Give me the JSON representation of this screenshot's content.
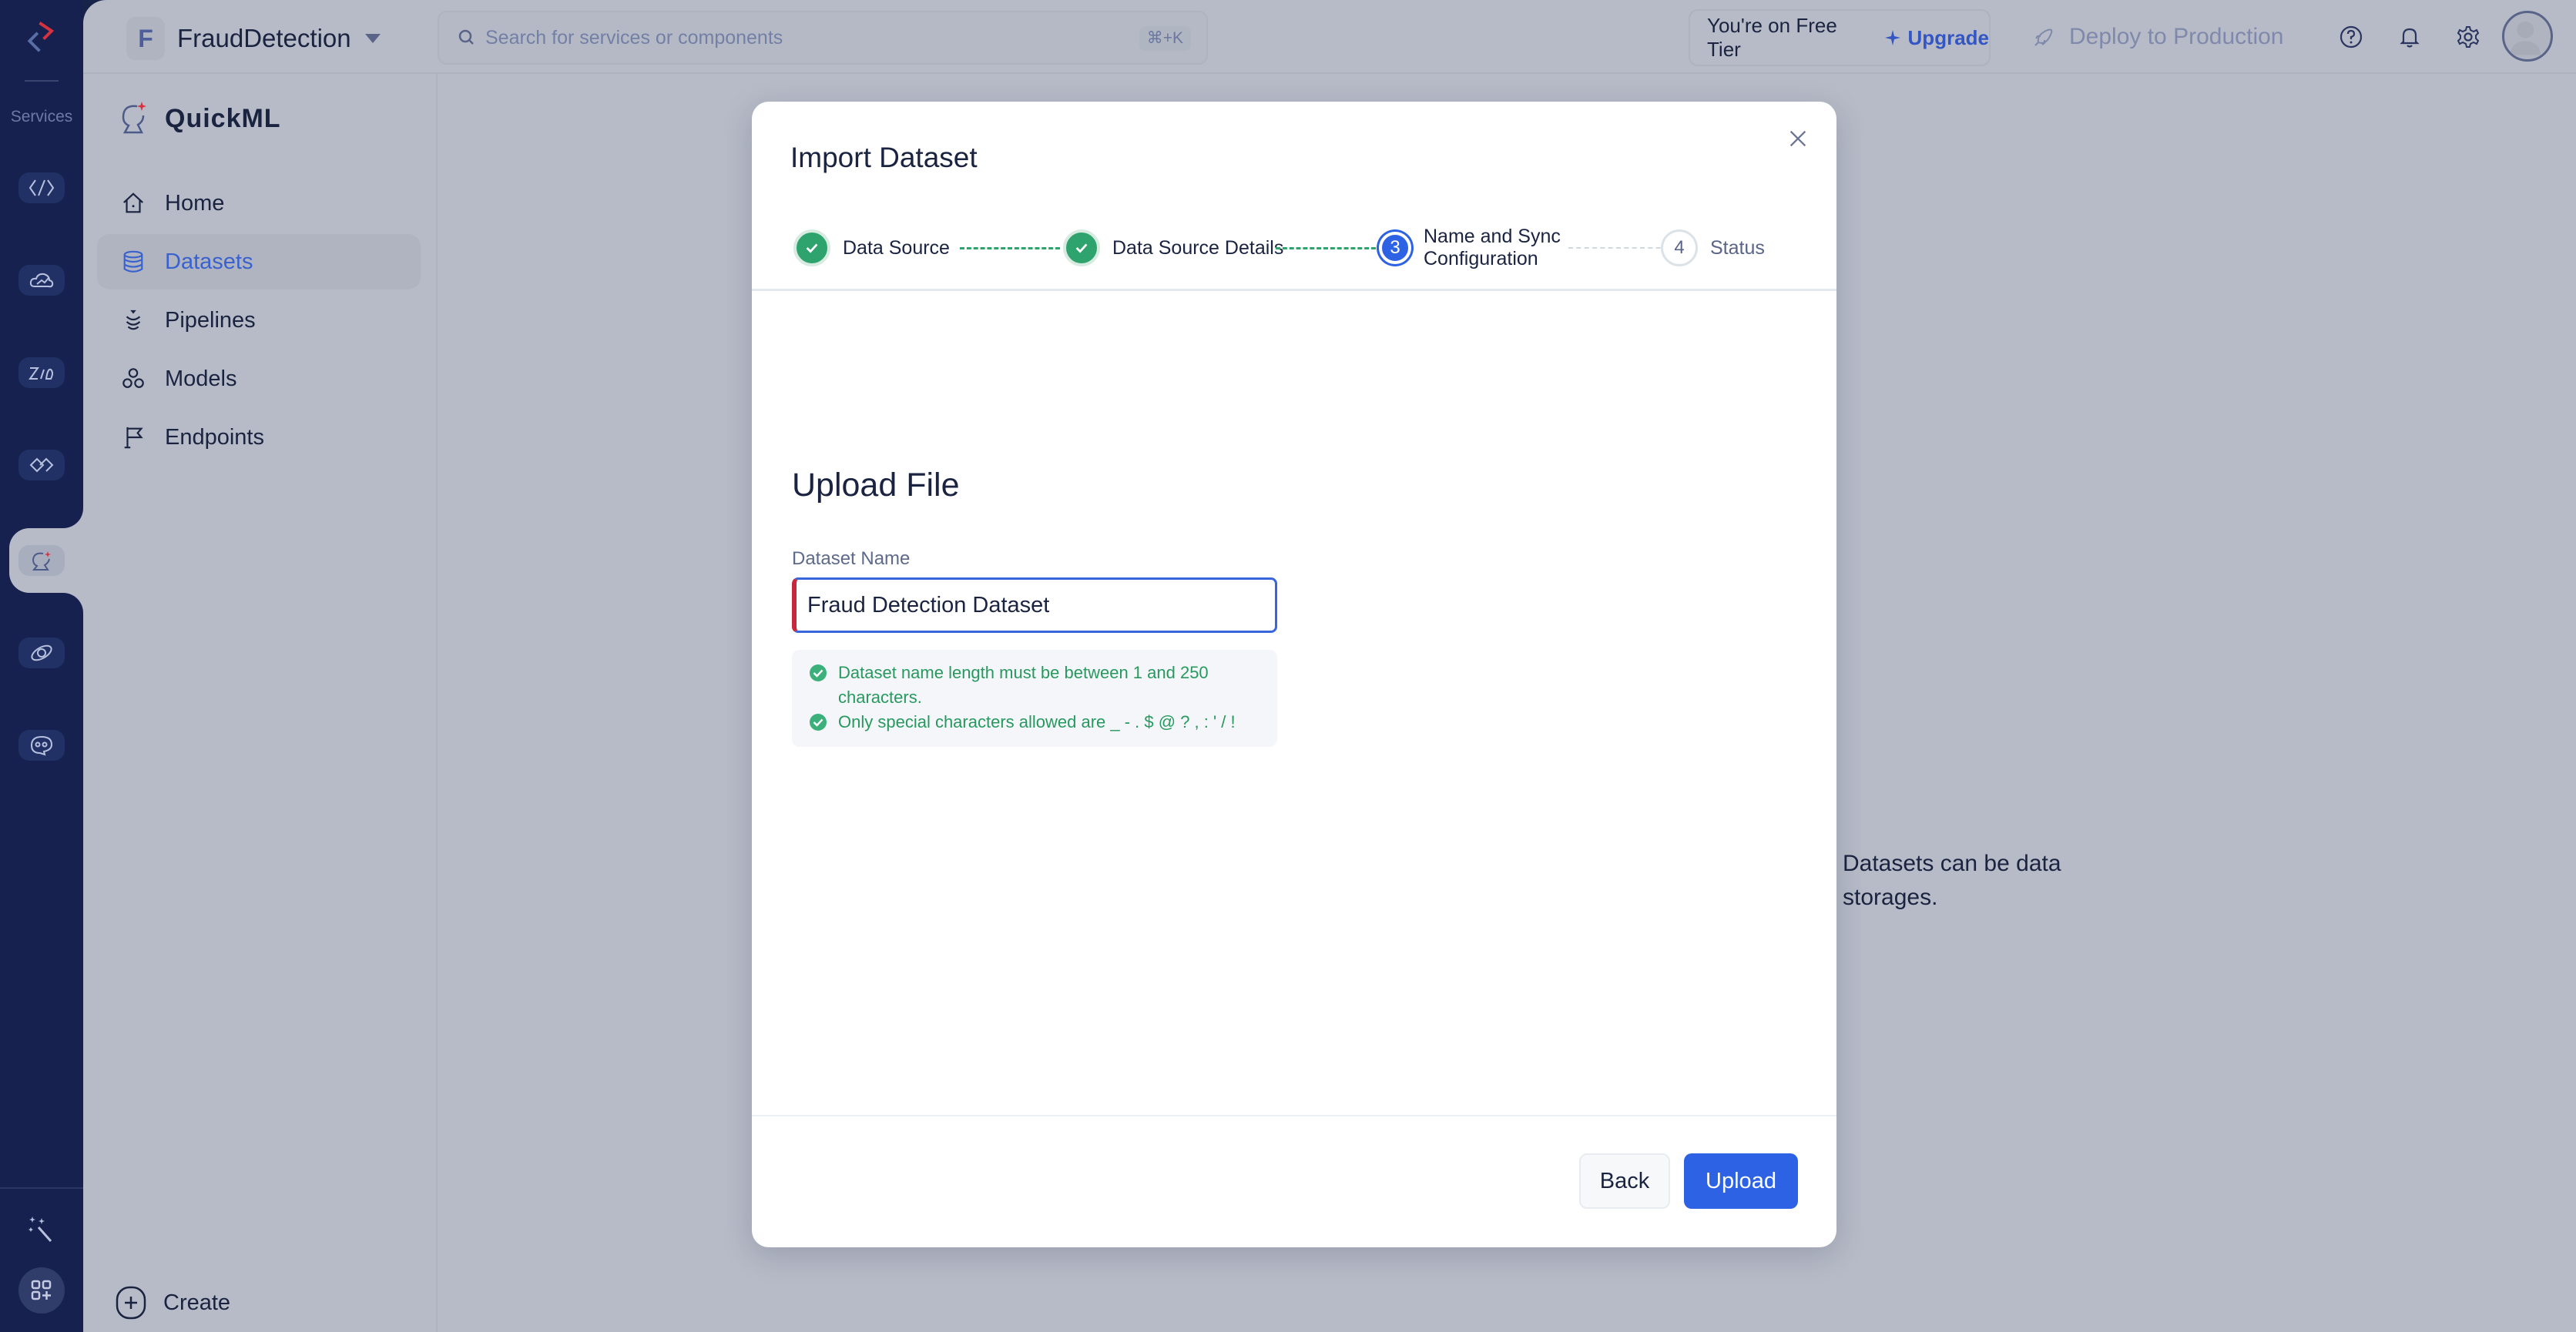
{
  "rail": {
    "label": "Services",
    "items": [
      {
        "name": "code-service-icon"
      },
      {
        "name": "cloud-service-icon"
      },
      {
        "name": "zia-service-icon"
      },
      {
        "name": "integration-service-icon"
      },
      {
        "name": "quickml-service-icon",
        "active": true
      },
      {
        "name": "orbit-service-icon"
      },
      {
        "name": "chatbot-service-icon"
      }
    ]
  },
  "topbar": {
    "org_initial": "F",
    "org_name": "FraudDetection",
    "search_placeholder": "Search for services or components",
    "search_shortcut": "⌘+K",
    "tier_text": "You're on Free Tier",
    "upgrade_label": "Upgrade",
    "deploy_label": "Deploy to Production"
  },
  "nav": {
    "product_name": "QuickML",
    "items": [
      {
        "label": "Home",
        "icon": "home-icon"
      },
      {
        "label": "Datasets",
        "icon": "database-icon",
        "active": true
      },
      {
        "label": "Pipelines",
        "icon": "pipeline-icon"
      },
      {
        "label": "Models",
        "icon": "models-icon"
      },
      {
        "label": "Endpoints",
        "icon": "flag-icon"
      }
    ],
    "create_label": "Create"
  },
  "background": {
    "hint_text": "Datasets can be data storages."
  },
  "modal": {
    "title": "Import Dataset",
    "steps": [
      {
        "number": "1",
        "label": "Data Source",
        "state": "done"
      },
      {
        "number": "2",
        "label": "Data Source Details",
        "state": "done"
      },
      {
        "number": "3",
        "label": "Name and Sync Configuration",
        "state": "current"
      },
      {
        "number": "4",
        "label": "Status",
        "state": "pending"
      }
    ],
    "section_title": "Upload File",
    "field_label": "Dataset Name",
    "field_value": "Fraud Detection Dataset",
    "hints": [
      "Dataset name length must be between 1 and 250 characters.",
      "Only special characters allowed are _ - . $ @ ? , : ' / !"
    ],
    "back_label": "Back",
    "upload_label": "Upload"
  },
  "colors": {
    "primary": "#2d62e5",
    "success": "#2ea36d",
    "rail": "#172150",
    "error_marker": "#c7283b"
  }
}
